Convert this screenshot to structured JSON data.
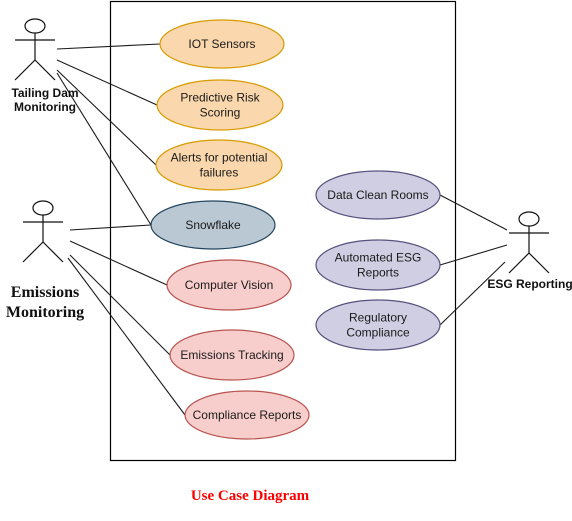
{
  "diagram": {
    "caption": "Use Case Diagram",
    "colors": {
      "orange_fill": "#fad7ac",
      "orange_stroke": "#d79b00",
      "slate_fill": "#bac8d3",
      "slate_stroke": "#23445d",
      "pink_fill": "#f8cecc",
      "pink_stroke": "#b85450",
      "purple_fill": "#d0cee2",
      "purple_stroke": "#56517e",
      "caption": "#ff0000"
    },
    "actors": [
      {
        "id": "tailing",
        "lines": [
          "Tailing Dam",
          "Monitoring"
        ],
        "style": "sans"
      },
      {
        "id": "emissions",
        "lines": [
          "Emissions",
          "Monitoring"
        ],
        "style": "serif"
      },
      {
        "id": "esg",
        "lines": [
          "ESG Reporting"
        ],
        "style": "sans"
      }
    ],
    "use_cases": [
      {
        "id": "iot",
        "lines": [
          "IOT Sensors"
        ],
        "color": "orange"
      },
      {
        "id": "risk",
        "lines": [
          "Predictive Risk",
          "Scoring"
        ],
        "color": "orange"
      },
      {
        "id": "alerts",
        "lines": [
          "Alerts for potential",
          "failures"
        ],
        "color": "orange"
      },
      {
        "id": "snowflake",
        "lines": [
          "Snowflake"
        ],
        "color": "slate"
      },
      {
        "id": "cv",
        "lines": [
          "Computer Vision"
        ],
        "color": "pink"
      },
      {
        "id": "tracking",
        "lines": [
          "Emissions Tracking"
        ],
        "color": "pink"
      },
      {
        "id": "compliance",
        "lines": [
          "Compliance Reports"
        ],
        "color": "pink"
      },
      {
        "id": "dcr",
        "lines": [
          "Data Clean Rooms"
        ],
        "color": "purple"
      },
      {
        "id": "autoesg",
        "lines": [
          "Automated ESG",
          "Reports"
        ],
        "color": "purple"
      },
      {
        "id": "regulatory",
        "lines": [
          "Regulatory",
          "Compliance"
        ],
        "color": "purple"
      }
    ],
    "associations": [
      [
        "tailing",
        "iot"
      ],
      [
        "tailing",
        "risk"
      ],
      [
        "tailing",
        "alerts"
      ],
      [
        "tailing",
        "snowflake"
      ],
      [
        "emissions",
        "snowflake"
      ],
      [
        "emissions",
        "cv"
      ],
      [
        "emissions",
        "tracking"
      ],
      [
        "emissions",
        "compliance"
      ],
      [
        "esg",
        "dcr"
      ],
      [
        "esg",
        "autoesg"
      ],
      [
        "esg",
        "regulatory"
      ]
    ]
  }
}
